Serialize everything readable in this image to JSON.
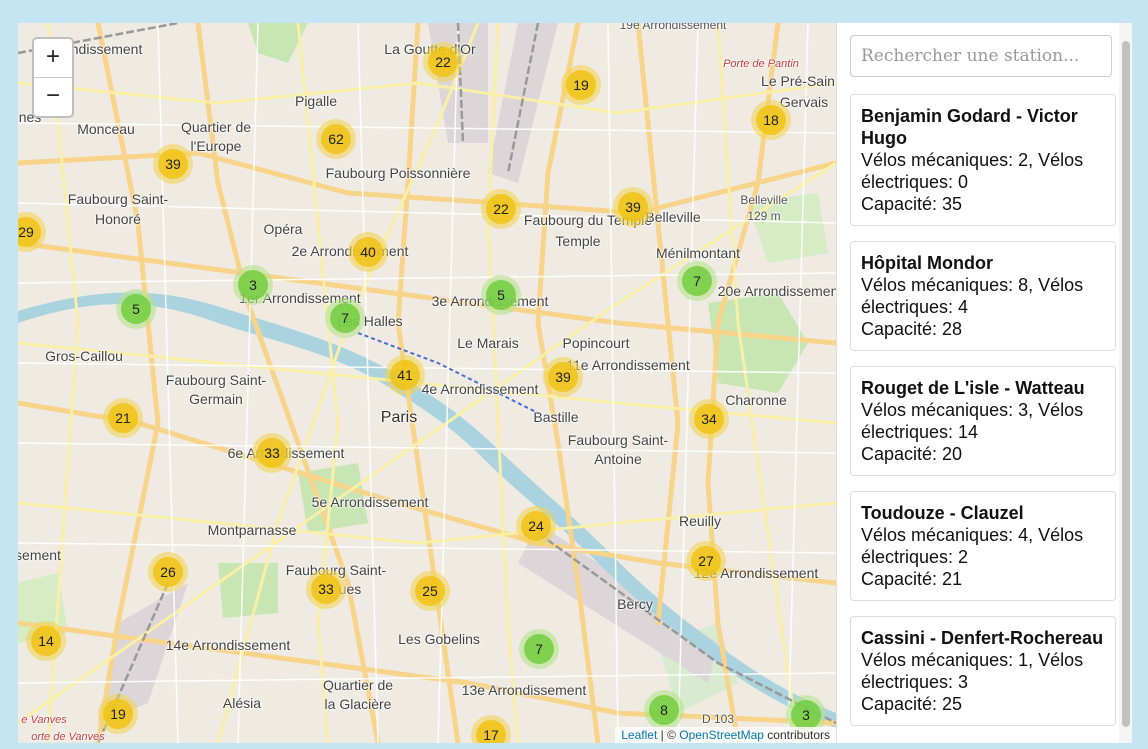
{
  "map": {
    "zoom_in": "+",
    "zoom_out": "−",
    "attribution": {
      "leaflet": "Leaflet",
      "sep": " | © ",
      "osm": "OpenStreetMap",
      "rest": " contributors"
    },
    "labels": [
      {
        "id": "arr19",
        "text": "19e Arrondissement"
      },
      {
        "id": "arr_cut",
        "text": "rrondissement"
      },
      {
        "id": "goutte",
        "text": "La Goutte d'Or"
      },
      {
        "id": "pantin",
        "text": "Porte de Pantin"
      },
      {
        "id": "presaint",
        "text": "Le Pré-Sain"
      },
      {
        "id": "gervais",
        "text": "Gervais"
      },
      {
        "id": "pigalle",
        "text": "Pigalle"
      },
      {
        "id": "monceau",
        "text": "Monceau"
      },
      {
        "id": "qeurope1",
        "text": "Quartier de"
      },
      {
        "id": "qeurope2",
        "text": "l'Europe"
      },
      {
        "id": "nes",
        "text": "nes"
      },
      {
        "id": "fpoiss",
        "text": "Faubourg Poissonnière"
      },
      {
        "id": "fsh1",
        "text": "Faubourg Saint-"
      },
      {
        "id": "fsh2",
        "text": "Honoré"
      },
      {
        "id": "opera",
        "text": "Opéra"
      },
      {
        "id": "arr2",
        "text": "2e Arrondissement"
      },
      {
        "id": "fdt1",
        "text": "Faubourg du Temple"
      },
      {
        "id": "fdt2",
        "text": "Temple"
      },
      {
        "id": "belleville",
        "text": "Belleville"
      },
      {
        "id": "menil",
        "text": "Ménilmontant"
      },
      {
        "id": "bellev2",
        "text": "Belleville"
      },
      {
        "id": "bellev129",
        "text": "129 m"
      },
      {
        "id": "arr1",
        "text": "1er Arrondissement"
      },
      {
        "id": "arr3",
        "text": "3e Arrondissement"
      },
      {
        "id": "arr20",
        "text": "20e Arrondissement"
      },
      {
        "id": "halles",
        "text": "Les Halles"
      },
      {
        "id": "marais",
        "text": "Le Marais"
      },
      {
        "id": "popincourt",
        "text": "Popincourt"
      },
      {
        "id": "arr11",
        "text": "11e Arrondissement"
      },
      {
        "id": "grosc",
        "text": "Gros-Caillou"
      },
      {
        "id": "fsg1",
        "text": "Faubourg Saint-"
      },
      {
        "id": "fsg2",
        "text": "Germain"
      },
      {
        "id": "arr4",
        "text": "4e Arrondissement"
      },
      {
        "id": "paris",
        "text": "Paris"
      },
      {
        "id": "bastille",
        "text": "Bastille"
      },
      {
        "id": "charonne",
        "text": "Charonne"
      },
      {
        "id": "fsa1",
        "text": "Faubourg Saint-"
      },
      {
        "id": "fsa2",
        "text": "Antoine"
      },
      {
        "id": "arr6",
        "text": "6e Arrondissement"
      },
      {
        "id": "arr5",
        "text": "5e Arrondissement"
      },
      {
        "id": "montp",
        "text": "Montparnasse"
      },
      {
        "id": "reuilly",
        "text": "Reuilly"
      },
      {
        "id": "sement",
        "text": "sement"
      },
      {
        "id": "fsj1",
        "text": "Faubourg Saint-"
      },
      {
        "id": "fsj2",
        "text": "ues"
      },
      {
        "id": "arr12",
        "text": "12e Arrondissement"
      },
      {
        "id": "bercy",
        "text": "Bercy"
      },
      {
        "id": "gobelins",
        "text": "Les Gobelins"
      },
      {
        "id": "arr14",
        "text": "14e Arrondissement"
      },
      {
        "id": "qgla1",
        "text": "Quartier de"
      },
      {
        "id": "qgla2",
        "text": "la Glacière"
      },
      {
        "id": "arr13",
        "text": "13e Arrondissement"
      },
      {
        "id": "alesia",
        "text": "Alésia"
      },
      {
        "id": "vanves1",
        "text": "e Vanves"
      },
      {
        "id": "vanves2",
        "text": "orte de Vanves"
      },
      {
        "id": "d103",
        "text": "D 103"
      }
    ],
    "clusters": [
      {
        "n": "22",
        "c": "y"
      },
      {
        "n": "19",
        "c": "y"
      },
      {
        "n": "18",
        "c": "y"
      },
      {
        "n": "62",
        "c": "y"
      },
      {
        "n": "39",
        "c": "y"
      },
      {
        "n": "22",
        "c": "y"
      },
      {
        "n": "39",
        "c": "y"
      },
      {
        "n": "29",
        "c": "y"
      },
      {
        "n": "40",
        "c": "y"
      },
      {
        "n": "3",
        "c": "g"
      },
      {
        "n": "5",
        "c": "g"
      },
      {
        "n": "7",
        "c": "g"
      },
      {
        "n": "5",
        "c": "g"
      },
      {
        "n": "7",
        "c": "g"
      },
      {
        "n": "41",
        "c": "y"
      },
      {
        "n": "39",
        "c": "y"
      },
      {
        "n": "21",
        "c": "y"
      },
      {
        "n": "34",
        "c": "y"
      },
      {
        "n": "33",
        "c": "y"
      },
      {
        "n": "24",
        "c": "y"
      },
      {
        "n": "27",
        "c": "y"
      },
      {
        "n": "26",
        "c": "y"
      },
      {
        "n": "33",
        "c": "y"
      },
      {
        "n": "25",
        "c": "y"
      },
      {
        "n": "14",
        "c": "y"
      },
      {
        "n": "7",
        "c": "g"
      },
      {
        "n": "19",
        "c": "y"
      },
      {
        "n": "8",
        "c": "g"
      },
      {
        "n": "3",
        "c": "g"
      },
      {
        "n": "17",
        "c": "y"
      }
    ]
  },
  "search": {
    "placeholder": "Rechercher une station..."
  },
  "stations": [
    {
      "name": "Benjamin Godard - Victor Hugo",
      "l1": "Vélos mécaniques: 2, Vélos",
      "l2": "électriques: 0",
      "cap": "Capacité: 35"
    },
    {
      "name": "Hôpital Mondor",
      "l1": "Vélos mécaniques: 8, Vélos",
      "l2": "électriques: 4",
      "cap": "Capacité: 28"
    },
    {
      "name": "Rouget de L'isle - Watteau",
      "l1": "Vélos mécaniques: 3, Vélos",
      "l2": "électriques: 14",
      "cap": "Capacité: 20"
    },
    {
      "name": "Toudouze - Clauzel",
      "l1": "Vélos mécaniques: 4, Vélos",
      "l2": "électriques: 2",
      "cap": "Capacité: 21"
    },
    {
      "name": "Cassini - Denfert-Rochereau",
      "l1": "Vélos mécaniques: 1, Vélos",
      "l2": "électriques: 3",
      "cap": "Capacité: 25"
    }
  ]
}
